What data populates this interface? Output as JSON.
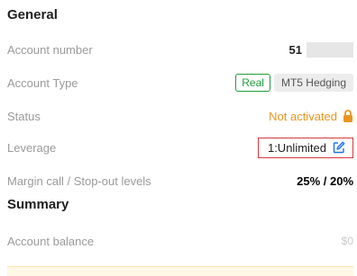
{
  "general": {
    "title": "General",
    "account_number": {
      "label": "Account number",
      "value": "51"
    },
    "account_type": {
      "label": "Account Type",
      "tag_real": "Real",
      "tag_type": "MT5 Hedging"
    },
    "status": {
      "label": "Status",
      "value": "Not activated"
    },
    "leverage": {
      "label": "Leverage",
      "value": "1:Unlimited"
    },
    "margin": {
      "label": "Margin call / Stop-out levels",
      "value": "25% / 20%"
    }
  },
  "summary": {
    "title": "Summary",
    "balance": {
      "label": "Account balance",
      "value": "$0"
    }
  },
  "colors": {
    "accent_green": "#1e9e3a",
    "status_orange": "#e8961e",
    "highlight_red": "#d9363e",
    "icon_blue": "#1a73e8"
  },
  "icons": {
    "status": "lock-icon",
    "leverage": "edit-icon"
  }
}
